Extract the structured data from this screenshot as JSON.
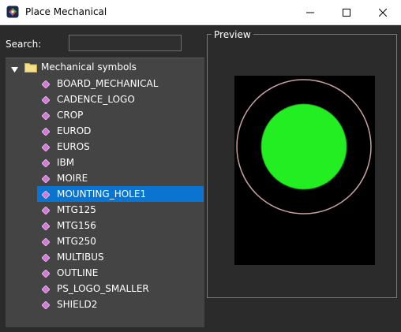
{
  "window": {
    "title": "Place Mechanical"
  },
  "search": {
    "label": "Search:",
    "value": "",
    "placeholder": ""
  },
  "tree": {
    "root_label": "Mechanical symbols",
    "items": [
      {
        "label": "BOARD_MECHANICAL"
      },
      {
        "label": "CADENCE_LOGO"
      },
      {
        "label": "CROP"
      },
      {
        "label": "EUROD"
      },
      {
        "label": "EUROS"
      },
      {
        "label": "IBM"
      },
      {
        "label": "MOIRE"
      },
      {
        "label": "MOUNTING_HOLE1"
      },
      {
        "label": "MTG125"
      },
      {
        "label": "MTG156"
      },
      {
        "label": "MTG250"
      },
      {
        "label": "MULTIBUS"
      },
      {
        "label": "OUTLINE"
      },
      {
        "label": "PS_LOGO_SMALLER"
      },
      {
        "label": "SHIELD2"
      }
    ],
    "selected": "MOUNTING_HOLE1"
  },
  "preview": {
    "label": "Preview",
    "colors": {
      "background": "#000000",
      "outer_ring": "#c8a0a0",
      "inner_fill": "#22ee22"
    }
  },
  "colors": {
    "selection": "#0a74d0",
    "symbol_icon": "#d07ad8"
  }
}
